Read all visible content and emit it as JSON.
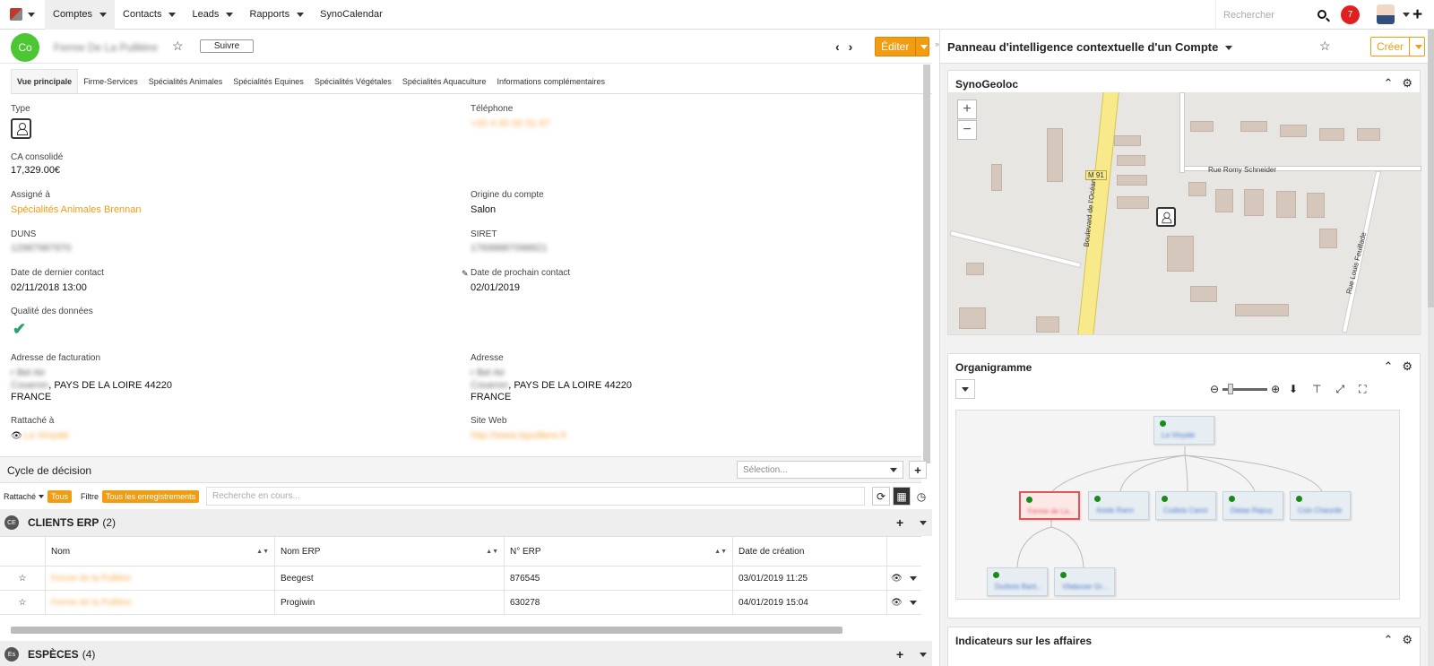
{
  "topnav": {
    "items": [
      {
        "label": "Comptes",
        "active": true
      },
      {
        "label": "Contacts"
      },
      {
        "label": "Leads"
      },
      {
        "label": "Rapports"
      },
      {
        "label": "SynoCalendar"
      }
    ],
    "search_placeholder": "Rechercher",
    "notifications": "7"
  },
  "record": {
    "initials": "Co",
    "name": "Ferme De La Pulllière",
    "follow": "Suivre",
    "edit": "Éditer"
  },
  "tabs": [
    "Vue principale",
    "Firme-Services",
    "Spécialités Animales",
    "Spécialités Equines",
    "Spécialités Végétales",
    "Spécialités Aquaculture",
    "Informations complémentaires"
  ],
  "fields": {
    "type_label": "Type",
    "phone_label": "Téléphone",
    "phone": "+33 4 00 00 51 87",
    "ca_label": "CA consolidé",
    "ca": "17,329.00€",
    "assigned_label": "Assigné à",
    "assigned": "Spécialités Animales Brennan",
    "origin_label": "Origine du compte",
    "origin": "Salon",
    "duns_label": "DUNS",
    "duns": "12987987970",
    "siret_label": "SIRET",
    "siret": "17698887098821",
    "last_contact_label": "Date de dernier contact",
    "last_contact": "02/11/2018 13:00",
    "next_contact_label": "Date de prochain contact",
    "next_contact": "02/01/2019",
    "quality_label": "Qualité des données",
    "billing_label": "Adresse de facturation",
    "billing_l1": "r Bel Air",
    "billing_l2a": "Coueron",
    "billing_l2b": ", PAYS DE LA LOIRE 44220",
    "billing_l3": "FRANCE",
    "address_label": "Adresse",
    "address_l1": "r Bel Air",
    "address_l2a": "Coueron",
    "address_l2b": ", PAYS DE LA LOIRE 44220",
    "address_l3": "FRANCE",
    "attached_label": "Rattaché à",
    "attached": "La Vinyale",
    "web_label": "Site Web",
    "web": "http://www.lapulliere.fr"
  },
  "cycle": {
    "title": "Cycle de décision",
    "select_placeholder": "Sélection..."
  },
  "filters": {
    "attached": "Rattaché",
    "all": "Tous",
    "filter": "Filtre",
    "all_records": "Tous les enregistrements",
    "search_placeholder": "Recherche en cours..."
  },
  "clients_erp": {
    "badge": "CE",
    "title": "CLIENTS ERP",
    "count": "(2)",
    "columns": [
      "Nom",
      "Nom ERP",
      "N° ERP",
      "Date de création"
    ],
    "rows": [
      {
        "name": "Ferme de la Pullière",
        "erp_name": "Beegest",
        "erp_no": "876545",
        "created": "03/01/2019 11:25"
      },
      {
        "name": "Ferme de la Pullière",
        "erp_name": "Progiwin",
        "erp_no": "630278",
        "created": "04/01/2019 15:04"
      }
    ]
  },
  "especes": {
    "badge": "Es",
    "title": "ESPÈCES",
    "count": "(4)"
  },
  "right_panel": {
    "title": "Panneau d'intelligence contextuelle d'un Compte",
    "create": "Créer",
    "geoloc_title": "SynoGeoloc",
    "org_title": "Organigramme",
    "indicators_title": "Indicateurs sur les affaires",
    "map_labels": {
      "m91": "M 91",
      "boulevard": "Boulevard de l'Océan",
      "romy": "Rue Romy Schneider",
      "feuillade": "Rue Louis Feuillade"
    },
    "org_nodes": [
      "La Vinyale",
      "Ferme de La...",
      "Anide Rann",
      "Codisis Canni",
      "Dataa Rapuy",
      "Coin Chaurde",
      "Durbois Bant...",
      "Vilabouer Gr..."
    ]
  },
  "colors": {
    "accent": "#f39c12",
    "avatar_green": "#4cc733",
    "notif_red": "#e02020"
  }
}
